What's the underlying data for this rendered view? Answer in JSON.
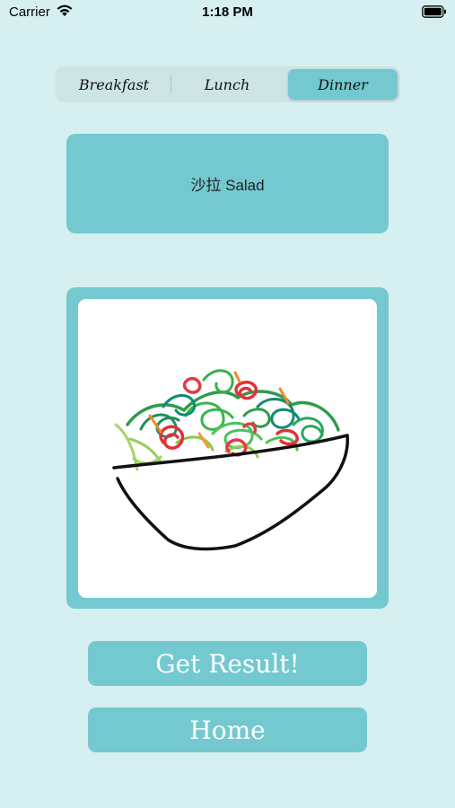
{
  "status_bar": {
    "carrier": "Carrier",
    "time": "1:18 PM"
  },
  "meal_tabs": {
    "items": [
      "Breakfast",
      "Lunch",
      "Dinner"
    ],
    "selected": "Dinner"
  },
  "result_text": "沙拉 Salad",
  "drawing": {
    "subject": "salad-bowl-drawing"
  },
  "buttons": {
    "get_result": "Get Result!",
    "home": "Home"
  },
  "colors": {
    "background": "#d6eff0",
    "accent": "#73c9cf",
    "segment_bg": "#cde3e4"
  }
}
